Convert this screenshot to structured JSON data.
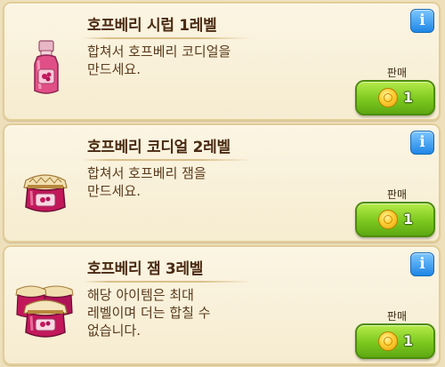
{
  "items": [
    {
      "title": "호프베리 시럽 1레벨",
      "desc_line1": "합쳐서 호프베리 코디얼을",
      "desc_line2": "만드세요.",
      "desc_line3": "",
      "sell_label": "판매",
      "price": "1",
      "icon": "syrup-bottle-icon"
    },
    {
      "title": "호프베리 코디얼 2레벨",
      "desc_line1": "합쳐서 호프베리 잼을",
      "desc_line2": "만드세요.",
      "desc_line3": "",
      "sell_label": "판매",
      "price": "1",
      "icon": "jam-jar-icon"
    },
    {
      "title": "호프베리 잼 3레벨",
      "desc_line1": "해당 아이템은 최대",
      "desc_line2": "레벨이며 더는 합칠 수",
      "desc_line3": "없습니다.",
      "sell_label": "판매",
      "price": "1",
      "icon": "jam-jars-stack-icon"
    }
  ],
  "info_symbol": "i",
  "colors": {
    "card_bg": "#f8efd6",
    "card_border": "#e2cd98",
    "title_text": "#4a2a12",
    "sell_button": "#7cc81f",
    "info_button": "#1f86e6",
    "coin": "#ffd23a"
  }
}
